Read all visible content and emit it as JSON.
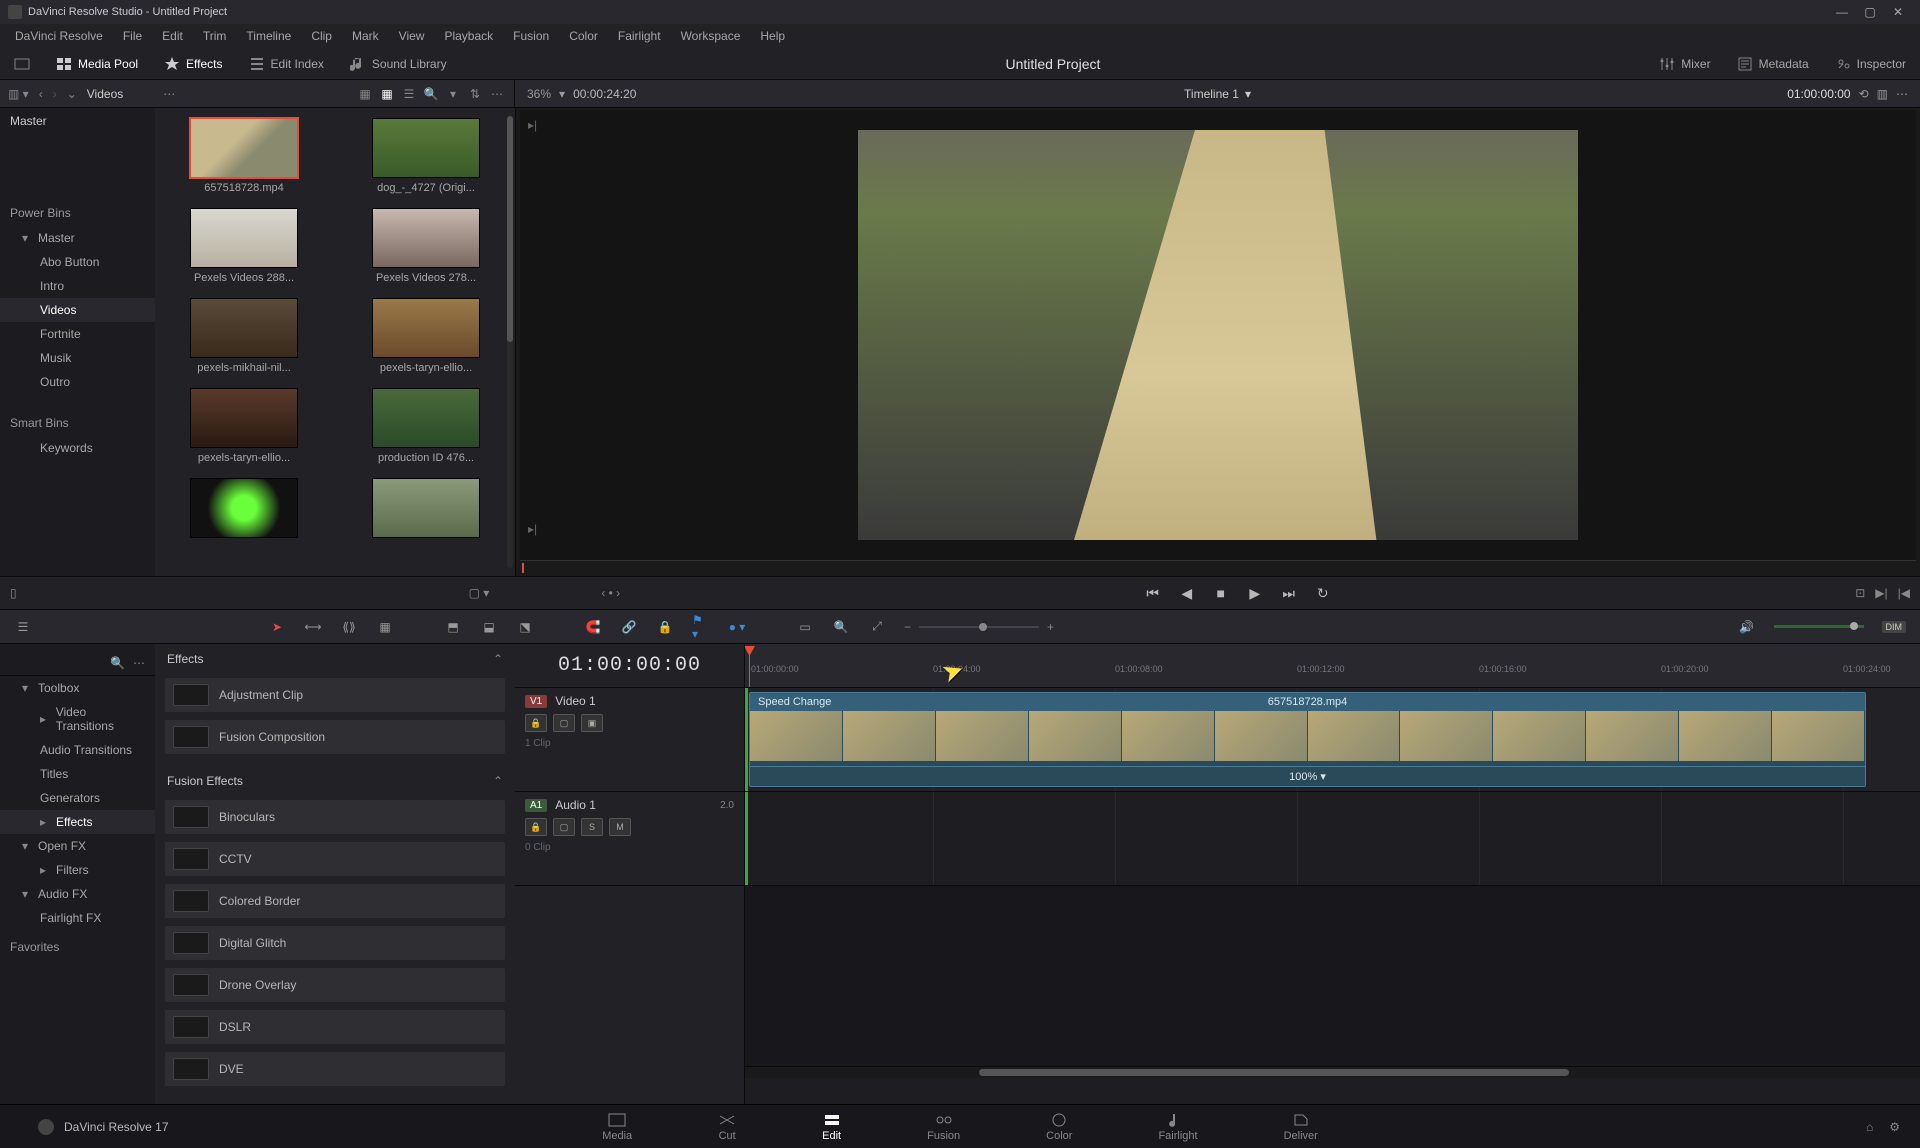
{
  "window": {
    "title": "DaVinci Resolve Studio - Untitled Project"
  },
  "menu": [
    "DaVinci Resolve",
    "File",
    "Edit",
    "Trim",
    "Timeline",
    "Clip",
    "Mark",
    "View",
    "Playback",
    "Fusion",
    "Color",
    "Fairlight",
    "Workspace",
    "Help"
  ],
  "toolbar": {
    "mediapool": "Media Pool",
    "effects": "Effects",
    "editindex": "Edit Index",
    "soundlib": "Sound Library",
    "project": "Untitled Project",
    "mixer": "Mixer",
    "metadata": "Metadata",
    "inspector": "Inspector"
  },
  "pool_header": {
    "breadcrumb": "Videos",
    "zoom_pct": "36%",
    "src_tc": "00:00:24:20",
    "timeline_name": "Timeline 1",
    "rec_tc": "01:00:00:00"
  },
  "bins": {
    "master": "Master",
    "power_label": "Power Bins",
    "power_master": "Master",
    "children": [
      "Abo Button",
      "Intro",
      "Videos",
      "Fortnite",
      "Musik",
      "Outro"
    ],
    "smart_label": "Smart Bins",
    "smart_children": [
      "Keywords"
    ]
  },
  "clips": [
    {
      "label": "657518728.mp4",
      "cls": "t-skate",
      "selected": true
    },
    {
      "label": "dog_-_4727 (Origi...",
      "cls": "t-dog"
    },
    {
      "label": "Pexels Videos 288...",
      "cls": "t-wide"
    },
    {
      "label": "Pexels Videos 278...",
      "cls": "t-woman"
    },
    {
      "label": "pexels-mikhail-nil...",
      "cls": "t-forest1"
    },
    {
      "label": "pexels-taryn-ellio...",
      "cls": "t-forest2"
    },
    {
      "label": "pexels-taryn-ellio...",
      "cls": "t-forest3"
    },
    {
      "label": "production ID 476...",
      "cls": "t-mount"
    },
    {
      "label": "",
      "cls": "t-green"
    },
    {
      "label": "",
      "cls": "t-man"
    }
  ],
  "effects_tree": {
    "toolbox": "Toolbox",
    "items": [
      "Video Transitions",
      "Audio Transitions",
      "Titles",
      "Generators",
      "Effects"
    ],
    "openfx": "Open FX",
    "filters": "Filters",
    "audiofx": "Audio FX",
    "fairlight": "Fairlight FX",
    "favorites": "Favorites"
  },
  "effects_list": {
    "h1": "Effects",
    "g1": [
      "Adjustment Clip",
      "Fusion Composition"
    ],
    "h2": "Fusion Effects",
    "g2": [
      "Binoculars",
      "CCTV",
      "Colored Border",
      "Digital Glitch",
      "Drone Overlay",
      "DSLR",
      "DVE"
    ]
  },
  "timeline": {
    "tc": "01:00:00:00",
    "ruler": [
      "01:00:00:00",
      "01:00:04:00",
      "01:00:08:00",
      "01:00:12:00",
      "01:00:16:00",
      "01:00:20:00",
      "01:00:24:00"
    ],
    "v1_badge": "V1",
    "v1_name": "Video 1",
    "v1_meta": "1 Clip",
    "a1_badge": "A1",
    "a1_name": "Audio 1",
    "a1_ch": "2.0",
    "a1_meta": "0 Clip",
    "clip_speed_label": "Speed Change",
    "clip_name": "657518728.mp4",
    "clip_speed_val": "100%",
    "btn_s": "S",
    "btn_m": "M",
    "dim": "DIM"
  },
  "pages": {
    "app": "DaVinci Resolve 17",
    "tabs": [
      "Media",
      "Cut",
      "Edit",
      "Fusion",
      "Color",
      "Fairlight",
      "Deliver"
    ]
  }
}
